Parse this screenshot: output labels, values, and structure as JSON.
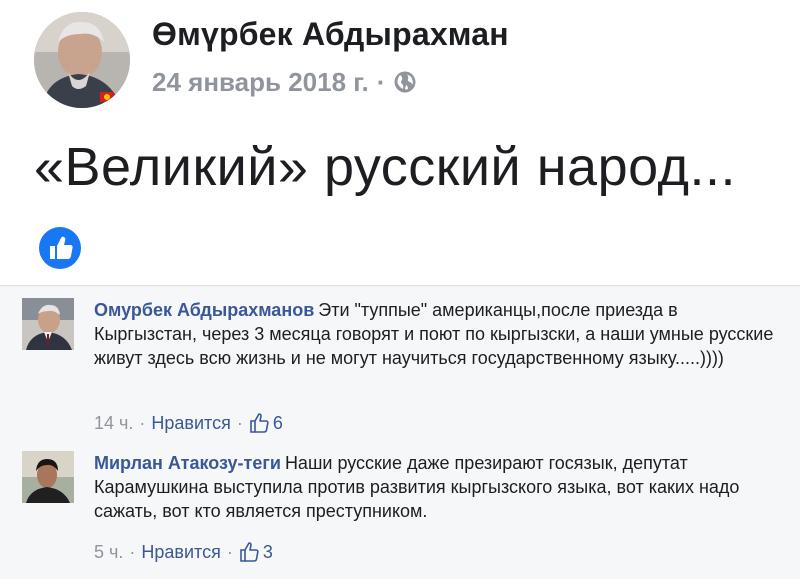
{
  "post": {
    "author": "Өмүрбек Абдырахман",
    "date": "24 январь 2018 г.",
    "separator": "·",
    "privacy_icon": "globe-icon",
    "text": "«Великий» русский народ...",
    "reaction_icon": "like-reaction-icon"
  },
  "comments": [
    {
      "author": "Омурбек Абдырахманов",
      "text": "Эти \"туппые\" американцы,после приезда в Кыргызстан, через 3 месяца говорят и поют по кыргызски, а наши умные русские живут здесь всю жизнь и не могут научиться государственному языку.....))))",
      "time": "14 ч.",
      "separator": "·",
      "like_label": "Нравится",
      "likes": "6"
    },
    {
      "author": "Мирлан Атакозу-теги",
      "text": "Наши русские даже презирают госязык, депутат Карамушкина выступила против развития кыргызского языка, вот каких надо сажать, вот кто является преступником.",
      "time": "5 ч.",
      "separator": "·",
      "like_label": "Нравится",
      "likes": "3"
    }
  ],
  "colors": {
    "link": "#385898",
    "meta": "#90949c",
    "text": "#1c1e21",
    "like_blue": "#1877f2",
    "comments_bg": "#f6f7f9"
  }
}
